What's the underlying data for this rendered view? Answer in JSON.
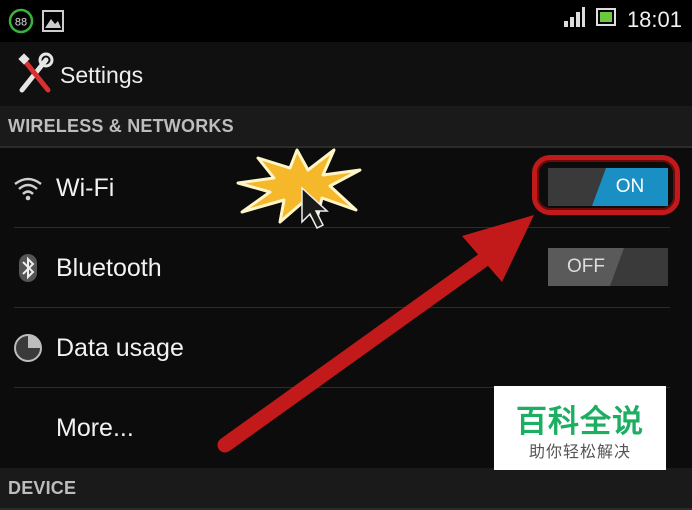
{
  "status_bar": {
    "time": "18:01",
    "notification_badge": "88",
    "icons": [
      "cleaner-badge-icon",
      "image-notification-icon",
      "signal-icon",
      "battery-icon"
    ]
  },
  "action_bar": {
    "title": "Settings",
    "icon": "settings-tools-icon"
  },
  "sections": [
    {
      "header": "WIRELESS & NETWORKS",
      "items": [
        {
          "label": "Wi-Fi",
          "icon": "wifi-icon",
          "toggle": "ON"
        },
        {
          "label": "Bluetooth",
          "icon": "bluetooth-icon",
          "toggle": "OFF"
        },
        {
          "label": "Data usage",
          "icon": "data-usage-icon"
        },
        {
          "label": "More..."
        }
      ]
    },
    {
      "header": "DEVICE"
    }
  ],
  "annotation": {
    "highlight_color": "#c21a1a",
    "arrow_color": "#c21a1a",
    "burst_color": "#f5b82a"
  },
  "watermark": {
    "title": "百科全说",
    "subtitle": "助你轻松解决"
  }
}
